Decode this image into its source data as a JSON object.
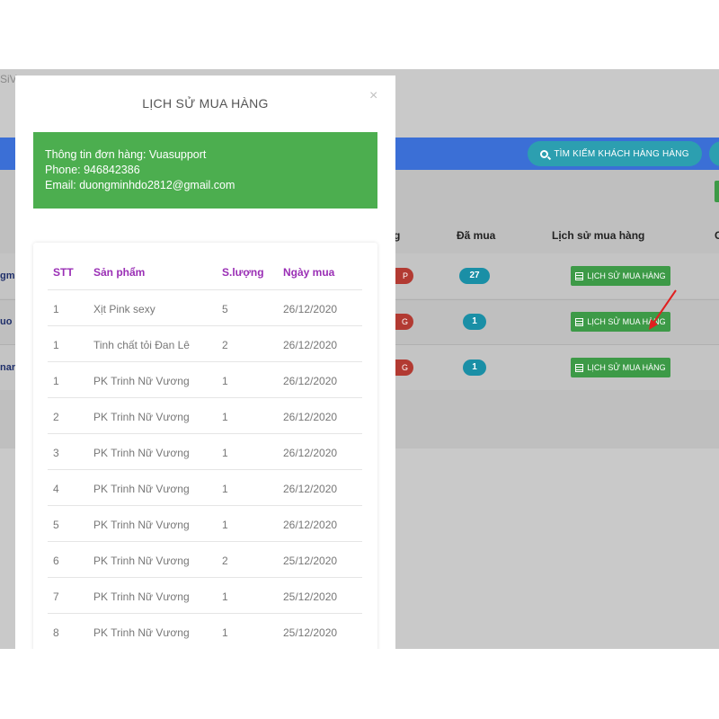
{
  "app": {
    "logo_fragment": "SiV",
    "search_button_label": "TÌM KIẾM KHÁCH HÀNG HÀNG",
    "columns": {
      "status_fragment": "g",
      "purchased": "Đã mua",
      "history": "Lịch sử mua hàng",
      "next_fragment": "C"
    },
    "rows": [
      {
        "name_fragment": "gmi",
        "badge_fragment": "P",
        "count": "27",
        "history_button": "LỊCH SỬ MUA HÀNG"
      },
      {
        "name_fragment": "uo",
        "badge_fragment": "G",
        "count": "1",
        "history_button": "LỊCH SỬ MUA HÀNG"
      },
      {
        "name_fragment": "nar",
        "badge_fragment": "G",
        "count": "1",
        "history_button": "LỊCH SỬ MUA HÀNG"
      }
    ],
    "colors": {
      "blue_bar": "#3b6fd6",
      "teal": "#2c9fb0",
      "green": "#3d9a47",
      "red_badge": "#b23a32",
      "arrow": "#e02020"
    }
  },
  "modal": {
    "title": "LỊCH SỬ MUA HÀNG",
    "close_icon": "×",
    "info": {
      "line1": "Thông tin đơn hàng: Vuasupport",
      "line2": "Phone: 946842386",
      "line3": "Email: duongminhdo2812@gmail.com"
    },
    "table": {
      "headers": [
        "STT",
        "Sản phẩm",
        "S.lượng",
        "Ngày mua"
      ],
      "rows": [
        [
          "1",
          "Xịt Pink sexy",
          "5",
          "26/12/2020"
        ],
        [
          "1",
          "Tinh chất tỏi Đan Lê",
          "2",
          "26/12/2020"
        ],
        [
          "1",
          "PK Trinh Nữ Vương",
          "1",
          "26/12/2020"
        ],
        [
          "2",
          "PK Trinh Nữ Vương",
          "1",
          "26/12/2020"
        ],
        [
          "3",
          "PK Trinh Nữ Vương",
          "1",
          "26/12/2020"
        ],
        [
          "4",
          "PK Trinh Nữ Vương",
          "1",
          "26/12/2020"
        ],
        [
          "5",
          "PK Trinh Nữ Vương",
          "1",
          "26/12/2020"
        ],
        [
          "6",
          "PK Trinh Nữ Vương",
          "2",
          "25/12/2020"
        ],
        [
          "7",
          "PK Trinh Nữ Vương",
          "1",
          "25/12/2020"
        ],
        [
          "8",
          "PK Trinh Nữ Vương",
          "1",
          "25/12/2020"
        ]
      ]
    },
    "colors": {
      "info_box": "#4cae4f",
      "header_text": "#9a2fb5"
    }
  }
}
